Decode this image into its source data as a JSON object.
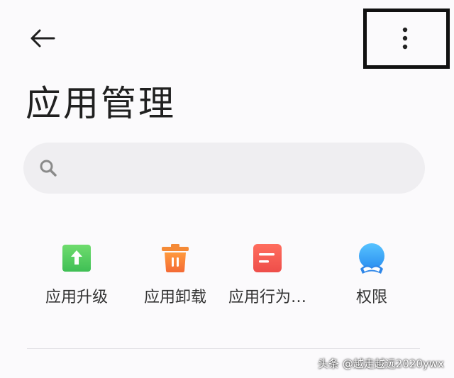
{
  "header": {
    "back_icon": "arrow-left-icon",
    "more_icon": "vertical-dots-icon"
  },
  "page": {
    "title": "应用管理"
  },
  "search": {
    "icon": "search-icon",
    "placeholder": "",
    "value": ""
  },
  "shortcuts": [
    {
      "label": "应用升级",
      "icon": "upgrade-arrow-icon",
      "color": "#4cc75a"
    },
    {
      "label": "应用卸载",
      "icon": "trash-icon",
      "color": "#f5793a"
    },
    {
      "label": "应用行为…",
      "icon": "document-lines-icon",
      "color": "#f25c54"
    },
    {
      "label": "权限",
      "icon": "shield-user-icon",
      "color": "#2d9ff5"
    }
  ],
  "watermark": {
    "text": "头条 @越走越远2020ywx"
  }
}
